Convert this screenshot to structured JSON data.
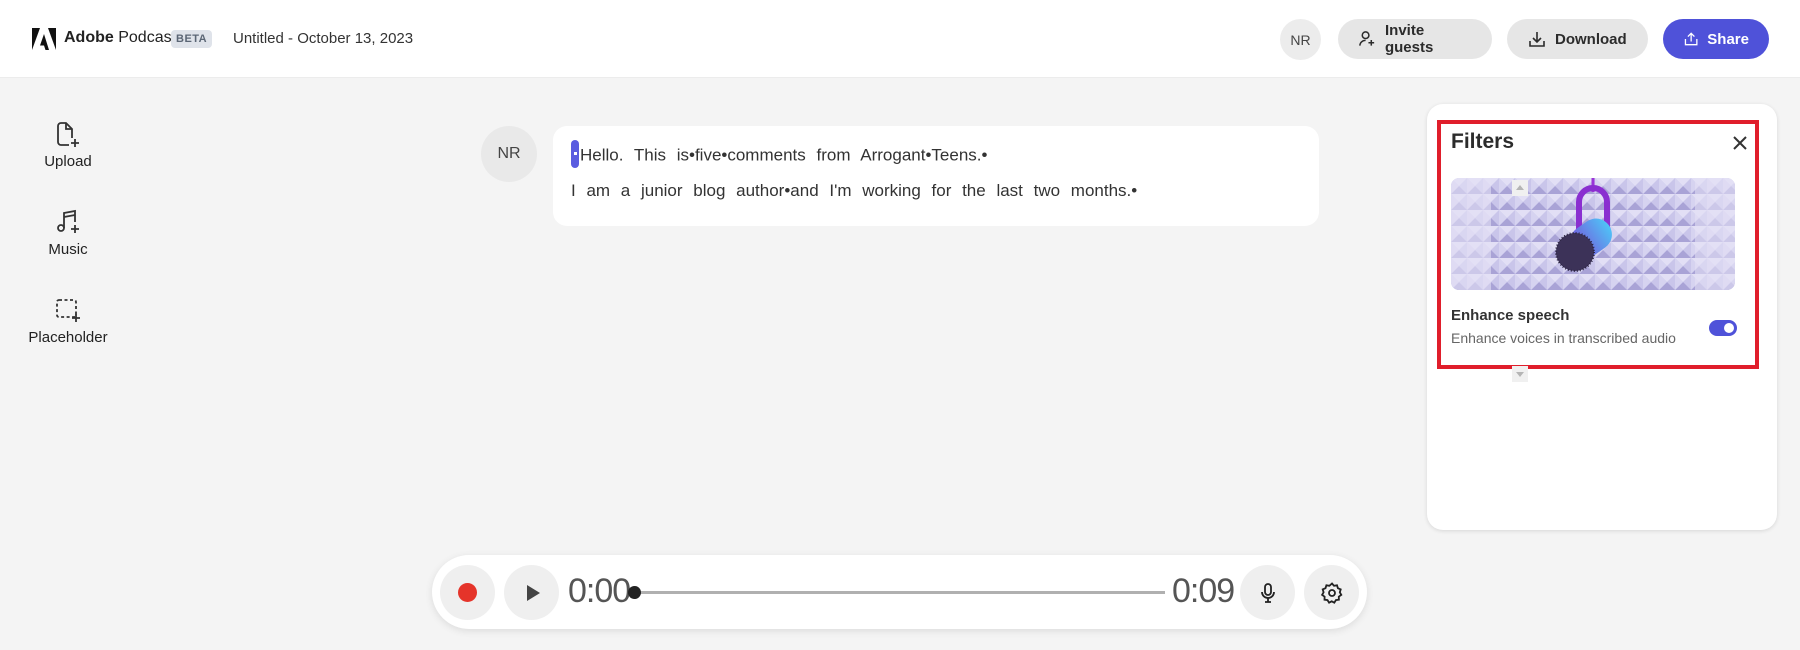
{
  "header": {
    "brand_bold": "Adobe",
    "brand_rest": " Podcast",
    "badge": "BETA",
    "doc_title": "Untitled - October 13, 2023",
    "avatar_initials": "NR",
    "invite_label": "Invite guests",
    "download_label": "Download",
    "share_label": "Share"
  },
  "sidebar": {
    "items": [
      {
        "label": "Upload",
        "icon": "file-add-icon"
      },
      {
        "label": "Music",
        "icon": "music-add-icon"
      },
      {
        "label": "Placeholder",
        "icon": "placeholder-add-icon"
      }
    ]
  },
  "transcript": {
    "speaker_initials": "NR",
    "lines": [
      "Hello. This is•five•comments from Arrogant•Teens.•",
      "I am a junior blog author•and I'm working for the last two months.•"
    ]
  },
  "filters_panel": {
    "title": "Filters",
    "filter_name": "Enhance speech",
    "filter_description": "Enhance voices in transcribed audio",
    "enabled": true
  },
  "player": {
    "current_time": "0:00",
    "total_time": "0:09",
    "progress": 0
  },
  "colors": {
    "accent": "#4f52d9",
    "record": "#e5342a",
    "highlight": "#e01e2b"
  }
}
